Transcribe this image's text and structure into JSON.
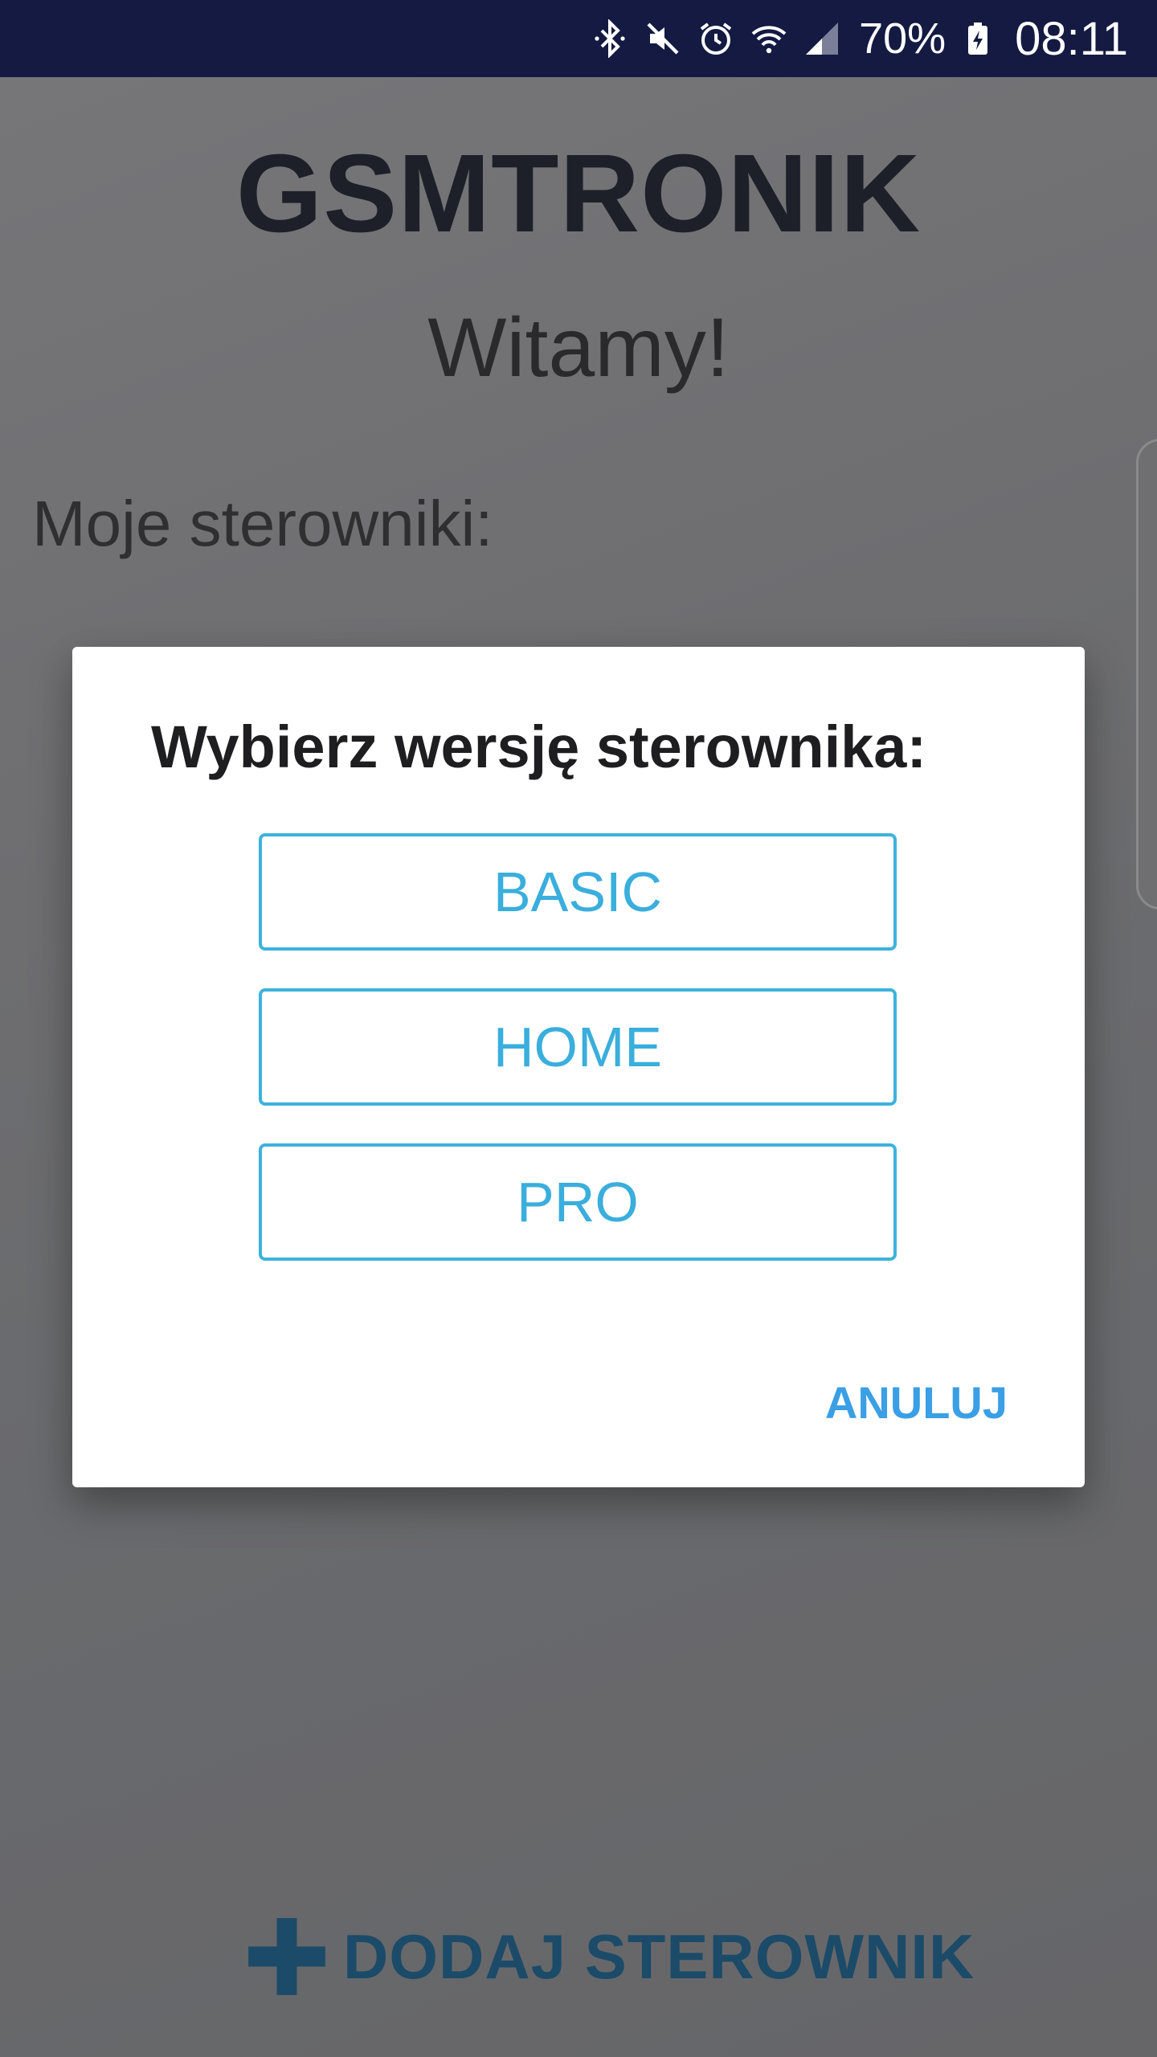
{
  "status_bar": {
    "icons": [
      "bluetooth-icon",
      "mute-icon",
      "alarm-icon",
      "wifi-icon",
      "signal-icon",
      "battery-charging-icon"
    ],
    "battery": "70%",
    "time": "08:11"
  },
  "app": {
    "title": "GSMTRONIK",
    "welcome": "Witamy!",
    "controllers_label": "Moje sterowniki:",
    "add_controller_label": "DODAJ STEROWNIK",
    "add_icon": "plus-icon",
    "colors": {
      "accent": "#3aaedc",
      "add_button": "#1b4b68",
      "status_bar": "#141a42"
    }
  },
  "dialog": {
    "title": "Wybierz wersję sterownika:",
    "options": [
      "BASIC",
      "HOME",
      "PRO"
    ],
    "cancel_label": "ANULUJ"
  }
}
